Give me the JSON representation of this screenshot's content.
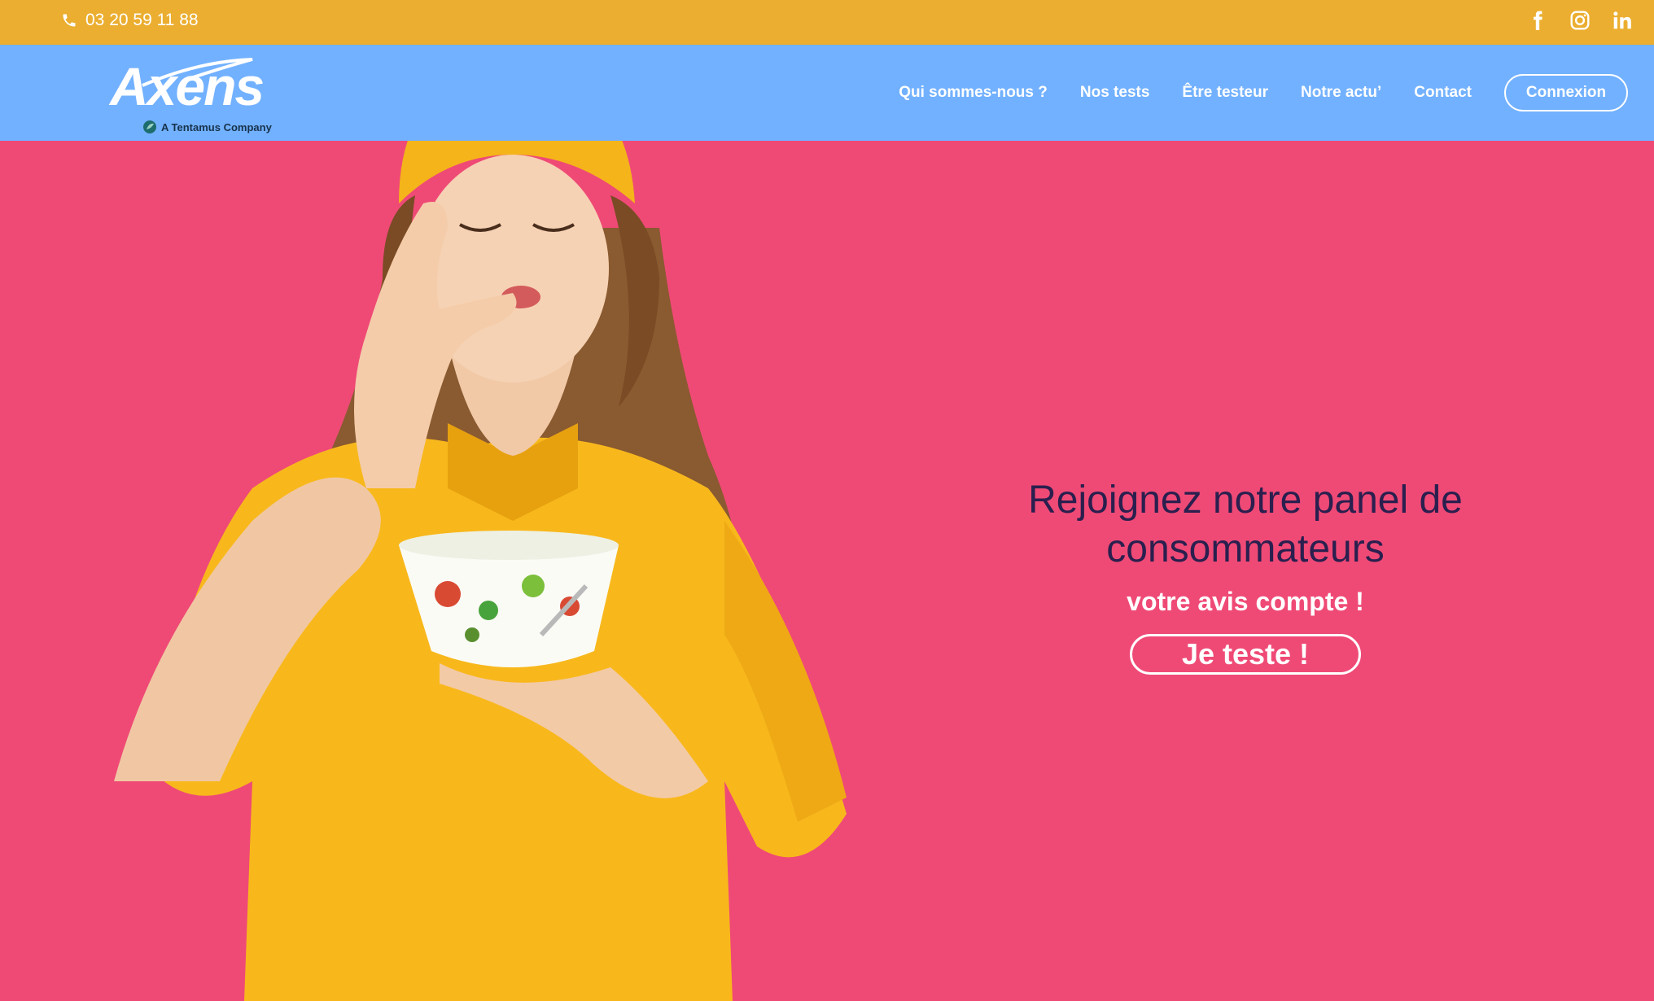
{
  "topbar": {
    "phone_icon": "phone-icon",
    "phone": "03 20 59 11 88",
    "social": [
      {
        "name": "facebook",
        "icon": "facebook-icon"
      },
      {
        "name": "instagram",
        "icon": "instagram-icon"
      },
      {
        "name": "linkedin",
        "icon": "linkedin-icon"
      }
    ],
    "color": "#ebae30"
  },
  "header": {
    "logo_text": "Axens",
    "logo_tagline": "A Tentamus Company",
    "nav": [
      "Qui sommes-nous ?",
      "Nos tests",
      "Être testeur",
      "Notre actu’",
      "Contact"
    ],
    "login_label": "Connexion",
    "color": "#72b1ff"
  },
  "hero": {
    "title": "Rejoignez notre panel de consommateurs",
    "subtitle": "votre avis compte !",
    "cta_label": "Je teste !",
    "background": "#ef4a76",
    "title_color": "#2a1f4e"
  }
}
